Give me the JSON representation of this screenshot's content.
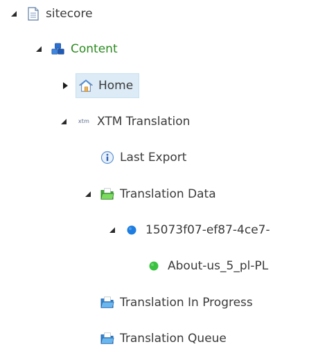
{
  "tree": {
    "nodes": [
      {
        "label": "sitecore",
        "icon": "document-icon",
        "expanded": true
      },
      {
        "label": "Content",
        "icon": "blocks-icon",
        "expanded": true
      },
      {
        "label": "Home",
        "icon": "home-icon",
        "expanded": false,
        "selected": true
      },
      {
        "label": "XTM Translation",
        "icon": "xtm-logo-icon",
        "icon_text": "xtm",
        "expanded": true
      },
      {
        "label": "Last Export",
        "icon": "info-icon"
      },
      {
        "label": "Translation Data",
        "icon": "green-folder-icon",
        "expanded": true
      },
      {
        "label": "15073f07-ef87-4ce7-",
        "icon": "blue-dot-icon",
        "expanded": true
      },
      {
        "label": "About-us_5_pl-PL",
        "icon": "green-dot-icon"
      },
      {
        "label": "Translation In Progress",
        "icon": "blue-folder-icon"
      },
      {
        "label": "Translation Queue",
        "icon": "blue-folder-icon"
      }
    ]
  },
  "colors": {
    "text": "#3a3a3a",
    "content_green": "#2b8a1f",
    "selection_bg": "#dcebf6",
    "blue_dot": "#1e7de0",
    "green_dot": "#3ac142",
    "folder_blue": "#3f9ee6",
    "folder_green": "#56c441"
  }
}
